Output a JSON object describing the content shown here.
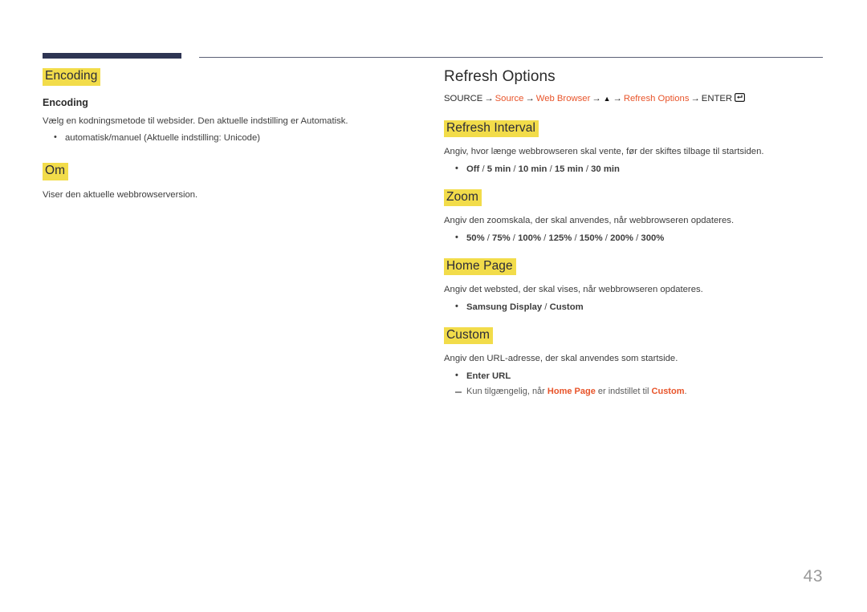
{
  "page": {
    "number": "43",
    "accent_color": "#e8542a",
    "highlight_color": "#f2dc4a",
    "rule_color": "#2e3553"
  },
  "left_column": {
    "heading": "Encoding",
    "sub_heading": "Encoding",
    "description": "Vælg en kodningsmetode til websider. Den aktuelle indstilling er Automatisk.",
    "bullet": "automatisk/manuel (Aktuelle indstilling: Unicode)",
    "second_heading": "Om",
    "second_description": "Viser den aktuelle webbrowserversion."
  },
  "right_column": {
    "title": "Refresh Options",
    "breadcrumb": {
      "source_label": "SOURCE",
      "arrow": "→",
      "source_link": "Source",
      "web_browser": "Web Browser",
      "triangle": "▲",
      "refresh_options": "Refresh Options",
      "enter_label": "ENTER",
      "enter_icon": "enter-key-icon"
    },
    "sections": [
      {
        "heading": "Refresh Interval",
        "description": "Angiv, hvor længe webbrowseren skal vente, før der skiftes tilbage til startsiden.",
        "options": [
          "Off",
          "5 min",
          "10 min",
          "15 min",
          "30 min"
        ],
        "separator": "/"
      },
      {
        "heading": "Zoom",
        "description": "Angiv den zoomskala, der skal anvendes, når webbrowseren opdateres.",
        "options": [
          "50%",
          "75%",
          "100%",
          "125%",
          "150%",
          "200%",
          "300%"
        ],
        "separator": "/"
      },
      {
        "heading": "Home Page",
        "description": "Angiv det websted, der skal vises, når webbrowseren opdateres.",
        "options": [
          "Samsung Display",
          "Custom"
        ],
        "separator": "/"
      },
      {
        "heading": "Custom",
        "description": "Angiv den URL-adresse, der skal anvendes som startside.",
        "options": [
          "Enter URL"
        ],
        "separator": "/",
        "note": {
          "prefix": "Kun tilgængelig, når ",
          "accent1": "Home Page",
          "middle": " er indstillet til ",
          "accent2": "Custom",
          "suffix": "."
        }
      }
    ]
  }
}
